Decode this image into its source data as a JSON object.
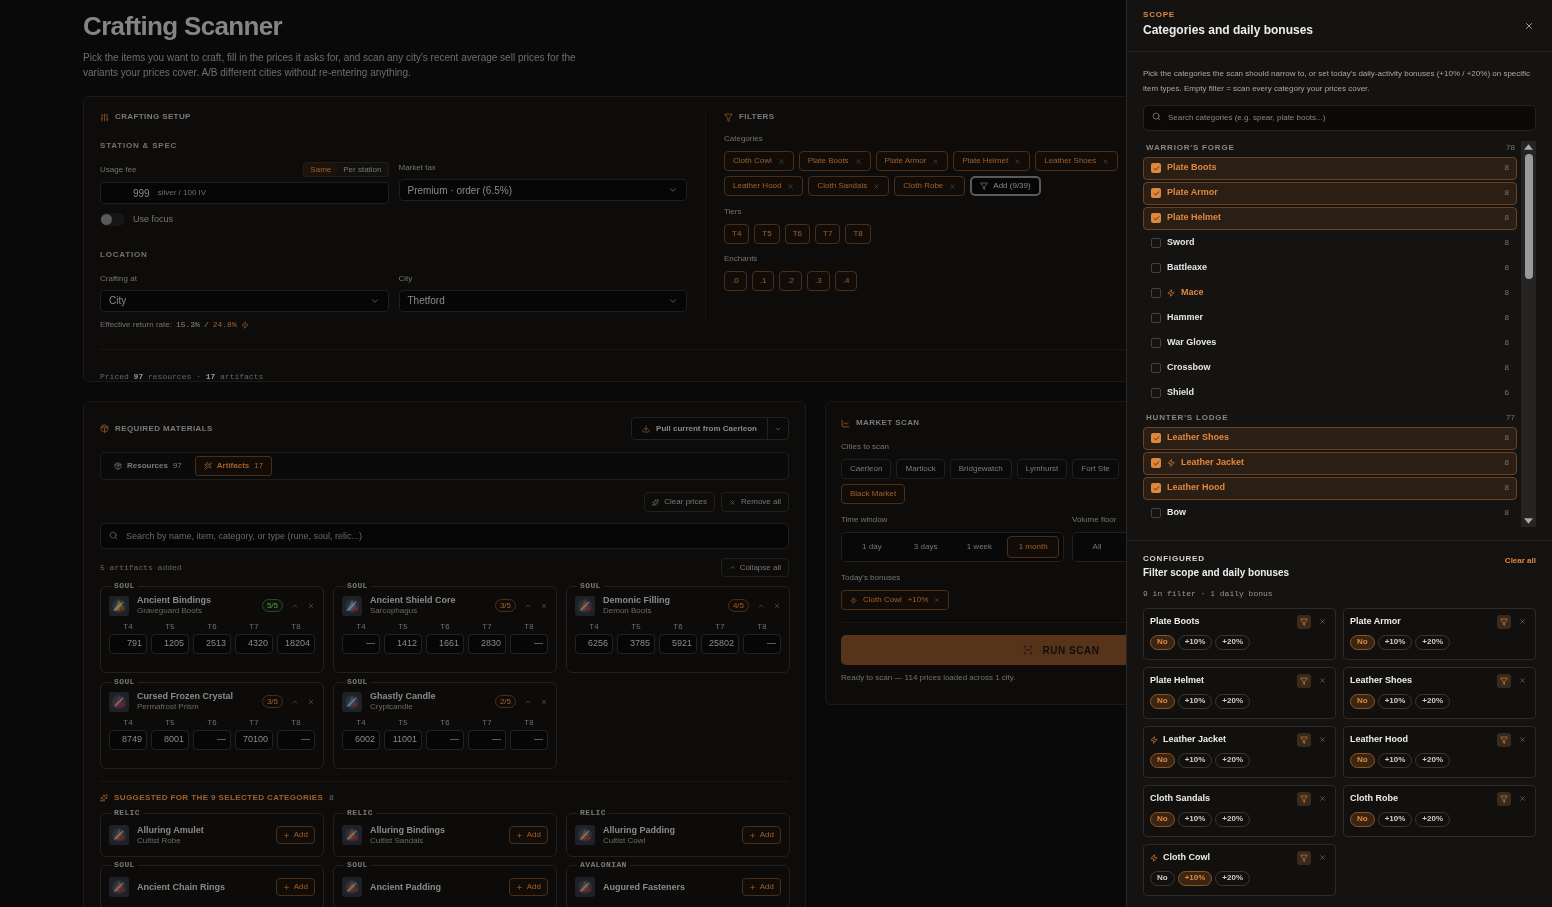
{
  "header": {
    "title": "Crafting Scanner",
    "description": "Pick the items you want to craft, fill in the prices it asks for, and scan any city's recent average sell prices for the variants your prices cover. A/B different cities without re-entering anything."
  },
  "setup": {
    "title": "CRAFTING SETUP",
    "station_heading": "STATION & SPEC",
    "usage_fee": {
      "label": "Usage fee",
      "modes": [
        {
          "label": "Same",
          "selected": true
        },
        {
          "label": "Per station",
          "selected": false
        }
      ],
      "value": "999",
      "unit": "silver / 100 IV"
    },
    "market_tax": {
      "label": "Market tax",
      "value": "Premium · order (6.5%)"
    },
    "use_focus": {
      "label": "Use focus",
      "on": false
    },
    "location_heading": "LOCATION",
    "crafting_at": {
      "label": "Crafting at",
      "value": "City"
    },
    "city": {
      "label": "City",
      "value": "Thetford"
    },
    "return_rate": {
      "label": "Effective return rate:",
      "base": "15.3%",
      "separator": "/",
      "focus": "24.8%"
    },
    "priced": "Priced **97** resources · **17** artifacts"
  },
  "filters": {
    "title": "FILTERS",
    "categories_label": "Categories",
    "categories": [
      "Cloth Cowl",
      "Plate Boots",
      "Plate Armor",
      "Plate Helmet",
      "Leather Shoes",
      "Leather Hood",
      "Cloth Sandals",
      "Cloth Robe"
    ],
    "add_button": "Add (9/39)",
    "tiers_label": "Tiers",
    "tiers": [
      {
        "label": "T4",
        "selected": true
      },
      {
        "label": "T5",
        "selected": true
      },
      {
        "label": "T6",
        "selected": true
      },
      {
        "label": "T7",
        "selected": true
      },
      {
        "label": "T8",
        "selected": true
      }
    ],
    "enchants_label": "Enchants",
    "enchants": [
      {
        "label": ".0",
        "selected": true
      },
      {
        "label": ".1",
        "selected": true
      },
      {
        "label": ".2",
        "selected": true
      },
      {
        "label": ".3",
        "selected": true
      },
      {
        "label": ".4",
        "selected": true
      }
    ]
  },
  "materials": {
    "title": "REQUIRED MATERIALS",
    "pull_button": "Pull current from Caerleon",
    "tabs": [
      {
        "label": "Resources",
        "count": "97",
        "selected": false
      },
      {
        "label": "Artifacts",
        "count": "17",
        "selected": true
      }
    ],
    "clear_button": "Clear prices",
    "remove_button": "Remove all",
    "search_placeholder": "Search by name, item, category, or type (rune, soul, relic...)",
    "added": "5 artifacts added",
    "collapse_button": "Collapse all",
    "artifacts": [
      {
        "type": "SOUL",
        "name": "Ancient Bindings",
        "subtitle": "Graveguard Boots",
        "progress": "5/5",
        "complete": true,
        "prices": [
          {
            "tier": "T4",
            "value": "791"
          },
          {
            "tier": "T5",
            "value": "1205"
          },
          {
            "tier": "T6",
            "value": "2513"
          },
          {
            "tier": "T7",
            "value": "4320"
          },
          {
            "tier": "T8",
            "value": "18204"
          }
        ]
      },
      {
        "type": "SOUL",
        "name": "Ancient Shield Core",
        "subtitle": "Sarcophagus",
        "progress": "3/5",
        "complete": false,
        "prices": [
          {
            "tier": "T4",
            "value": "—"
          },
          {
            "tier": "T5",
            "value": "1412"
          },
          {
            "tier": "T6",
            "value": "1661"
          },
          {
            "tier": "T7",
            "value": "2830"
          },
          {
            "tier": "T8",
            "value": "—"
          }
        ]
      },
      {
        "type": "SOUL",
        "name": "Demonic Filling",
        "subtitle": "Demon Boots",
        "progress": "4/5",
        "complete": false,
        "prices": [
          {
            "tier": "T4",
            "value": "6256"
          },
          {
            "tier": "T5",
            "value": "3785"
          },
          {
            "tier": "T6",
            "value": "5921"
          },
          {
            "tier": "T7",
            "value": "25802"
          },
          {
            "tier": "T8",
            "value": "—"
          }
        ]
      },
      {
        "type": "SOUL",
        "name": "Cursed Frozen Crystal",
        "subtitle": "Permafrost Prism",
        "progress": "3/5",
        "complete": false,
        "prices": [
          {
            "tier": "T4",
            "value": "8749"
          },
          {
            "tier": "T5",
            "value": "8001"
          },
          {
            "tier": "T6",
            "value": "—"
          },
          {
            "tier": "T7",
            "value": "70100"
          },
          {
            "tier": "T8",
            "value": "—"
          }
        ]
      },
      {
        "type": "SOUL",
        "name": "Ghastly Candle",
        "subtitle": "Cryptcandle",
        "progress": "2/5",
        "complete": false,
        "prices": [
          {
            "tier": "T4",
            "value": "6002"
          },
          {
            "tier": "T5",
            "value": "11001"
          },
          {
            "tier": "T6",
            "value": "—"
          },
          {
            "tier": "T7",
            "value": "—"
          },
          {
            "tier": "T8",
            "value": "—"
          }
        ]
      }
    ],
    "suggested_title": "SUGGESTED FOR THE 9 SELECTED CATEGORIES",
    "suggested_count": "8",
    "suggested": [
      {
        "type": "RELIC",
        "name": "Alluring Amulet",
        "subtitle": "Cultist Robe",
        "button": "Add"
      },
      {
        "type": "RELIC",
        "name": "Alluring Bindings",
        "subtitle": "Cultist Sandals",
        "button": "Add"
      },
      {
        "type": "RELIC",
        "name": "Alluring Padding",
        "subtitle": "Cultist Cowl",
        "button": "Add"
      },
      {
        "type": "SOUL",
        "name": "Ancient Chain Rings",
        "button": "Add"
      },
      {
        "type": "SOUL",
        "name": "Ancient Padding",
        "button": "Add"
      },
      {
        "type": "AVALONIAN",
        "name": "Augured Fasteners",
        "button": "Add"
      }
    ]
  },
  "market": {
    "title": "MARKET SCAN",
    "cities_label": "Cities to scan",
    "cities": [
      {
        "label": "Caerleon",
        "selected": false
      },
      {
        "label": "Martlock",
        "selected": false
      },
      {
        "label": "Bridgewatch",
        "selected": false
      },
      {
        "label": "Lymhurst",
        "selected": false
      },
      {
        "label": "Fort Ste",
        "selected": false
      },
      {
        "label": "Black Market",
        "selected": true
      }
    ],
    "time_label": "Time window",
    "time_options": [
      {
        "label": "1 day",
        "selected": false
      },
      {
        "label": "3 days",
        "selected": false
      },
      {
        "label": "1 week",
        "selected": false
      },
      {
        "label": "1 month",
        "selected": true
      }
    ],
    "volume_label": "Volume floor",
    "volume_options": [
      {
        "label": "All",
        "selected": false
      }
    ],
    "bonuses_label": "Today's bonuses",
    "bonuses": [
      {
        "label": "Cloth Cowl",
        "amount": "+10%"
      }
    ],
    "run_button": "RUN SCAN",
    "status": "Ready to scan — 114 prices loaded across 1 city."
  },
  "panel": {
    "eyebrow": "SCOPE",
    "title": "Categories and daily bonuses",
    "description": "Pick the categories the scan should narrow to, or set today's daily-activity bonuses (+10% / +20%) on specific item types. Empty filter = scan every category your prices cover.",
    "search_placeholder": "Search categories (e.g. spear, plate boots...)",
    "groups": [
      {
        "name": "WARRIOR'S FORGE",
        "count": "78",
        "items": [
          {
            "label": "Plate Boots",
            "count": "8",
            "checked": true,
            "bonus": false
          },
          {
            "label": "Plate Armor",
            "count": "8",
            "checked": true,
            "bonus": false
          },
          {
            "label": "Plate Helmet",
            "count": "8",
            "checked": true,
            "bonus": false
          },
          {
            "label": "Sword",
            "count": "8",
            "checked": false,
            "bonus": false
          },
          {
            "label": "Battleaxe",
            "count": "8",
            "checked": false,
            "bonus": false
          },
          {
            "label": "Mace",
            "count": "8",
            "checked": false,
            "bonus": true
          },
          {
            "label": "Hammer",
            "count": "8",
            "checked": false,
            "bonus": false
          },
          {
            "label": "War Gloves",
            "count": "8",
            "checked": false,
            "bonus": false
          },
          {
            "label": "Crossbow",
            "count": "8",
            "checked": false,
            "bonus": false
          },
          {
            "label": "Shield",
            "count": "6",
            "checked": false,
            "bonus": false
          }
        ]
      },
      {
        "name": "HUNTER'S LODGE",
        "count": "77",
        "items": [
          {
            "label": "Leather Shoes",
            "count": "8",
            "checked": true,
            "bonus": false
          },
          {
            "label": "Leather Jacket",
            "count": "8",
            "checked": true,
            "bonus": true
          },
          {
            "label": "Leather Hood",
            "count": "8",
            "checked": true,
            "bonus": false
          },
          {
            "label": "Bow",
            "count": "8",
            "checked": false,
            "bonus": false
          }
        ]
      }
    ],
    "configured": {
      "eyebrow": "CONFIGURED",
      "title": "Filter scope and daily bonuses",
      "clear_button": "Clear all",
      "summary": "9 in filter · 1 daily bonus",
      "cards": [
        {
          "name": "Plate Boots",
          "bonus": false,
          "options": [
            {
              "label": "No",
              "selected": true
            },
            {
              "label": "+10%",
              "selected": false
            },
            {
              "label": "+20%",
              "selected": false
            }
          ]
        },
        {
          "name": "Plate Armor",
          "bonus": false,
          "options": [
            {
              "label": "No",
              "selected": true
            },
            {
              "label": "+10%",
              "selected": false
            },
            {
              "label": "+20%",
              "selected": false
            }
          ]
        },
        {
          "name": "Plate Helmet",
          "bonus": false,
          "options": [
            {
              "label": "No",
              "selected": true
            },
            {
              "label": "+10%",
              "selected": false
            },
            {
              "label": "+20%",
              "selected": false
            }
          ]
        },
        {
          "name": "Leather Shoes",
          "bonus": false,
          "options": [
            {
              "label": "No",
              "selected": true
            },
            {
              "label": "+10%",
              "selected": false
            },
            {
              "label": "+20%",
              "selected": false
            }
          ]
        },
        {
          "name": "Leather Jacket",
          "bonus": true,
          "options": [
            {
              "label": "No",
              "selected": true
            },
            {
              "label": "+10%",
              "selected": false
            },
            {
              "label": "+20%",
              "selected": false
            }
          ]
        },
        {
          "name": "Leather Hood",
          "bonus": false,
          "options": [
            {
              "label": "No",
              "selected": true
            },
            {
              "label": "+10%",
              "selected": false
            },
            {
              "label": "+20%",
              "selected": false
            }
          ]
        },
        {
          "name": "Cloth Sandals",
          "bonus": false,
          "options": [
            {
              "label": "No",
              "selected": true
            },
            {
              "label": "+10%",
              "selected": false
            },
            {
              "label": "+20%",
              "selected": false
            }
          ]
        },
        {
          "name": "Cloth Robe",
          "bonus": false,
          "options": [
            {
              "label": "No",
              "selected": true
            },
            {
              "label": "+10%",
              "selected": false
            },
            {
              "label": "+20%",
              "selected": false
            }
          ]
        },
        {
          "name": "Cloth Cowl",
          "bonus": true,
          "options": [
            {
              "label": "No",
              "selected": false
            },
            {
              "label": "+10%",
              "selected": true
            },
            {
              "label": "+20%",
              "selected": false
            }
          ]
        }
      ]
    }
  }
}
